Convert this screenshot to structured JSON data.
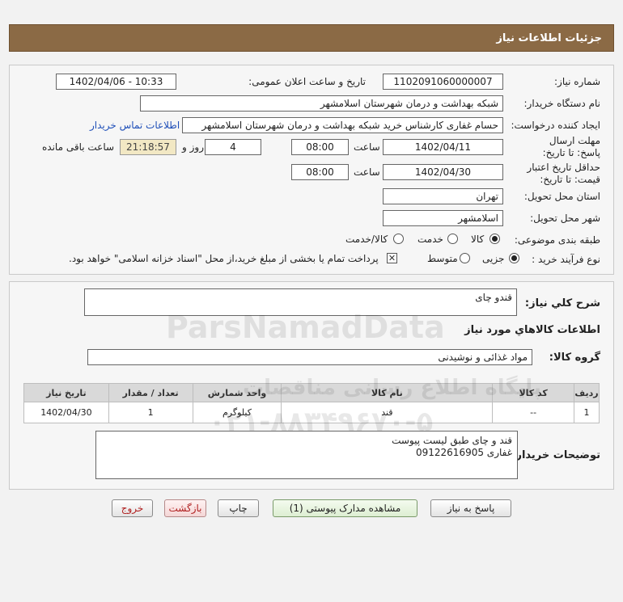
{
  "header": {
    "title": "جزئیات اطلاعات نیاز"
  },
  "fields": {
    "need_number_label": "شماره نیاز:",
    "need_number": "1102091060000007",
    "announce_label": "تاریخ و ساعت اعلان عمومی:",
    "announce_value": "1402/04/06 - 10:33",
    "buyer_org_label": "نام دستگاه خریدار:",
    "buyer_org": "شبکه بهداشت و درمان شهرستان اسلامشهر",
    "creator_label": "ایجاد کننده درخواست:",
    "creator": "حسام غفاری کارشناس خرید شبکه بهداشت و درمان شهرستان اسلامشهر",
    "contact_link": "اطلاعات تماس خریدار",
    "reply_deadline_label": "مهلت ارسال پاسخ: تا تاریخ:",
    "reply_date": "1402/04/11",
    "time_label": "ساعت",
    "reply_time": "08:00",
    "days": "4",
    "days_label": "روز و",
    "remaining_time": "21:18:57",
    "remaining_label": "ساعت باقی مانده",
    "price_validity_label": "حداقل تاریخ اعتبار قیمت: تا تاریخ:",
    "price_date": "1402/04/30",
    "price_time": "08:00",
    "province_label": "استان محل تحویل:",
    "province": "تهران",
    "city_label": "شهر محل تحویل:",
    "city": "اسلامشهر",
    "category_label": "طبقه بندی موضوعی:",
    "category_options": [
      "کالا",
      "خدمت",
      "کالا/خدمت"
    ],
    "process_label": "نوع فرآیند خرید :",
    "process_options": [
      "جزیی",
      "متوسط"
    ],
    "payment_note": "پرداخت تمام یا بخشی از مبلغ خرید،از محل \"اسناد خزانه اسلامی\" خواهد بود."
  },
  "summary": {
    "title_label": "شرح کلي نیاز:",
    "title_value": "قندو چای",
    "goods_info_title": "اطلاعات کالاهاي مورد نیاز",
    "group_label": "گروه کالا:",
    "group_value": "مواد غذائی و نوشیدنی"
  },
  "table": {
    "headers": [
      "ردیف",
      "کد کالا",
      "نام کالا",
      "واحد شمارش",
      "تعداد / مقدار",
      "تاریخ نیاز"
    ],
    "rows": [
      [
        "1",
        "--",
        "قند",
        "کیلوگرم",
        "1",
        "1402/04/30"
      ]
    ]
  },
  "buyer_notes": {
    "label": "توضیحات خریدار:",
    "line1": "قند و چای طبق لیست پیوست",
    "line2": "غفاری 09122616905"
  },
  "buttons": {
    "reply": "پاسخ به نیاز",
    "attachments": "مشاهده مدارک پیوستی (1)",
    "print": "چاپ",
    "back": "بازگشت",
    "exit": "خروج"
  },
  "watermark": {
    "brand": "ParsNamadData",
    "tagline": "پایگاه اطلاع رسانی مناقصات",
    "phone": "۰۲۱-۸۸۳۴۹۶۷۰-۵"
  }
}
